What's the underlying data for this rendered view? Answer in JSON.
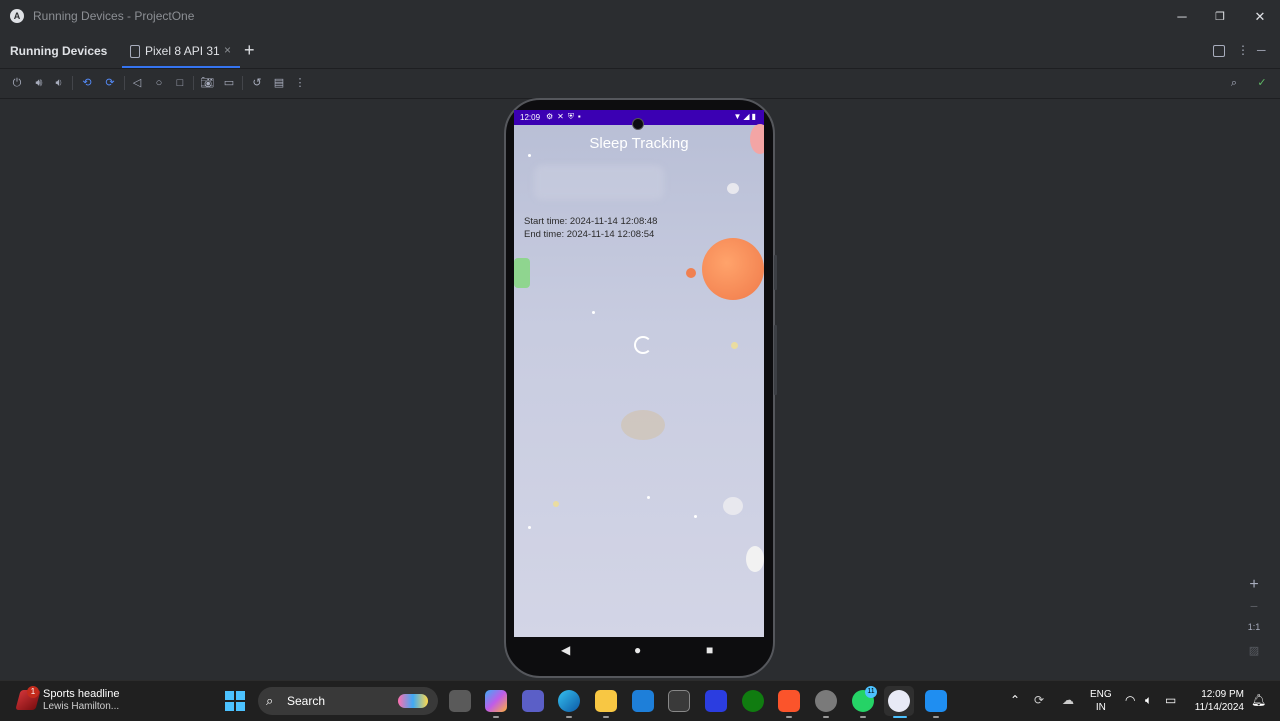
{
  "window": {
    "title": "Running Devices - ProjectOne",
    "logo_glyph": "A",
    "controls": {
      "minimize": "─",
      "restore": "❐",
      "close": "✕"
    }
  },
  "panel": {
    "title": "Running Devices",
    "tab_label": "Pixel 8 API 31",
    "tab_close": "×",
    "add_tab": "+"
  },
  "toolbar_icons": [
    "power-icon",
    "volume-up-icon",
    "volume-down-icon",
    "rotate-left-icon",
    "rotate-right-icon",
    "back-icon",
    "home-icon",
    "overview-icon",
    "screenshot-icon",
    "screen-record-icon",
    "reset-icon",
    "snapshot-icon",
    "more-icon"
  ],
  "device": {
    "status_time": "12:09",
    "app_title": "Sleep Tracking",
    "start_time": "Start time: 2024-11-14 12:08:48",
    "end_time": "End time: 2024-11-14 12:08:54"
  },
  "zoom": {
    "zoom_in": "+",
    "zoom_out": "−",
    "actual_size": "1:1"
  },
  "taskbar": {
    "news_badge": "1",
    "news_title": "Sports headline",
    "news_subtitle": "Lewis Hamilton...",
    "search_label": "Search",
    "whatsapp_badge": "11",
    "language_1": "ENG",
    "language_2": "IN",
    "time": "12:09 PM",
    "date": "11/14/2024"
  },
  "colors": {
    "accent": "#3574f0",
    "status_bar": "#3b00b3",
    "ide_bg": "#2b2d30"
  }
}
